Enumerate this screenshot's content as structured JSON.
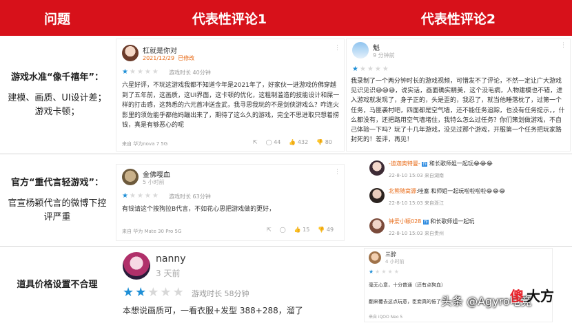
{
  "header": {
    "col1": "问题",
    "col2": "代表性评论1",
    "col3": "代表性评论2"
  },
  "rows": [
    {
      "title": "游戏水准“像千禧年”：",
      "desc": "建模、画质、UI设计差；游戏卡顿；"
    },
    {
      "title": "官方“重代言轻游戏”：",
      "desc": "官宣杨颖代言的微博下控评严重"
    },
    {
      "title": "道具价格设置不合理",
      "desc": ""
    }
  ],
  "colors": {
    "header": "#d7111a",
    "star_on": "#1f8fd6",
    "star_off": "#d8d8d8",
    "author_tag": "#e86a16"
  },
  "r1a": {
    "name": "杠就是你对",
    "date": "2021/12/29",
    "edited": "已修改",
    "stars": 1,
    "playtime": "游戏时长 40分钟",
    "body": "六星好评，不玩这游戏我都不知道今年是2021年了，好家伙一进游戏仿佛穿越到了五年前，这画质，这UI界面，这卡顿的优化，这粗制滥造的技能设计和屎一样的打击感，这熟悉的六元首冲送金武，我寻思我玩的不是剑侠游戏么？咋连火影里的须佐能乎都他妈蹦出来了，期待了这么久的游戏，完全不思进取只想着捞钱，真是有够恶心的呢",
    "device": "来自 华为nova 7 5G",
    "comments": "44",
    "likes": "432",
    "dislikes": "80"
  },
  "r1b": {
    "name": "魁",
    "time": "9 分钟前",
    "stars": 1,
    "body": "我录制了一个两分钟时长的游戏视频，可惜发不了评论，不然一定让广大游戏见识见识😅😅😅，说实话，画面确实精美，这个没毛病，人物建模也不错，进入游戏就发现了，身子正的，头是歪的，我忍了，就当他睡落枕了，过第一个任务，马匪袭村吧，四面都是空气墙，还不能任务追踪，也没有任务提示，，什么都没有，还把路用空气墙堵住，我特么怎么过任务？你们策划做游戏，不自己体验一下吗？玩了十几年游戏，没见过那个游戏，开服第一个任务把玩家路封死的！差评，再见！"
  },
  "r2a": {
    "name": "金佛嘤血",
    "time": "5 小时前",
    "stars": 1,
    "playtime": "游戏时长 63分钟",
    "body": "有钱请这个按狗拉B代言，不如花心思把游戏做的更好，",
    "device": "来自 华为 Mate 30 Pro 5G",
    "likes": "15",
    "dislikes": "49"
  },
  "r2b": {
    "comments": [
      {
        "user": "-迪迦奥特曼-",
        "text": "和长歌师姐一起玩😂😂😂",
        "date": "22-8-10 15:03",
        "loc": "来自湖南"
      },
      {
        "user": "北熊随窝源",
        "text": "哇塞 和师姐一起玩啦啦啦啦😂😂😂",
        "date": "22-8-10 15:03",
        "loc": "来自浙江"
      },
      {
        "user": "钟爱小颖028",
        "text": "和长歌师姐一起玩",
        "date": "22-8-10 15:03",
        "loc": "来自贵州"
      }
    ]
  },
  "r3a": {
    "name": "nanny",
    "time": "3 天前",
    "stars": 2,
    "playtime": "游戏时长 58分钟",
    "body": "本想说画质可，一看衣服+发型 388+288，溜了"
  },
  "r3b": {
    "name": "三醉",
    "time": "4 小时前",
    "stars": 1,
    "line1": "毫无心意，十分普通（还有点狗血）",
    "line2": "翻来覆去这点玩意，臣妾真的倦了",
    "device": "来自 iQOO Neo 5"
  },
  "watermark": {
    "text": "头条 @Agyro电竞",
    "logo1": "傻",
    "logo2": "大方"
  }
}
